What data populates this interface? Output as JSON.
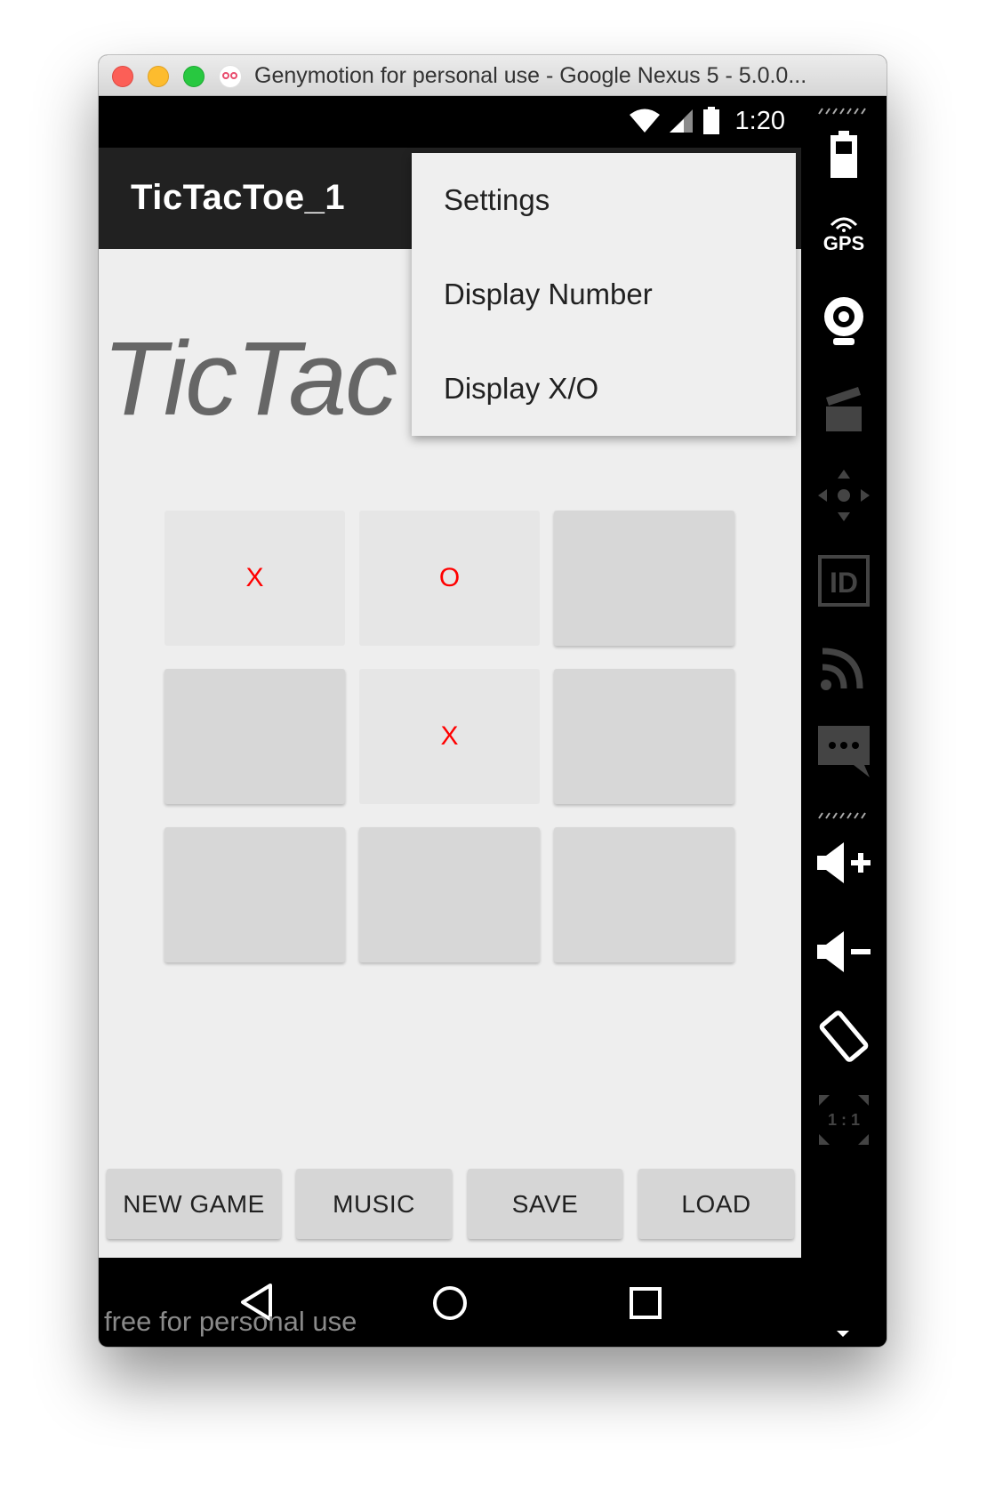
{
  "window": {
    "title": "Genymotion for personal use - Google Nexus 5 - 5.0.0..."
  },
  "status_bar": {
    "time": "1:20",
    "icons": [
      "wifi-icon",
      "signal-icon",
      "battery-icon"
    ]
  },
  "app_bar": {
    "title": "TicTacToe_1"
  },
  "overflow_menu": {
    "items": [
      "Settings",
      "Display Number",
      "Display X/O"
    ]
  },
  "main": {
    "big_title": "TicTac"
  },
  "board": {
    "cells": [
      "X",
      "O",
      "",
      "",
      "X",
      "",
      "",
      "",
      ""
    ],
    "mark_color": "#ff0000"
  },
  "buttons": {
    "new_game": "NEW GAME",
    "music": "MUSIC",
    "save": "SAVE",
    "load": "LOAD"
  },
  "nav_bar": {
    "icons": [
      "back-icon",
      "home-icon",
      "recents-icon"
    ],
    "watermark": "free for personal use"
  },
  "sidebar": {
    "gps_label": "GPS",
    "id_label": "ID",
    "scale_label": "1 : 1",
    "icons": [
      "battery-icon",
      "gps-icon",
      "camera-icon",
      "clapperboard-icon",
      "dpad-icon",
      "id-icon",
      "rss-icon",
      "sms-icon",
      "volume-up-icon",
      "volume-down-icon",
      "rotate-icon",
      "pixel-perfect-icon"
    ]
  }
}
